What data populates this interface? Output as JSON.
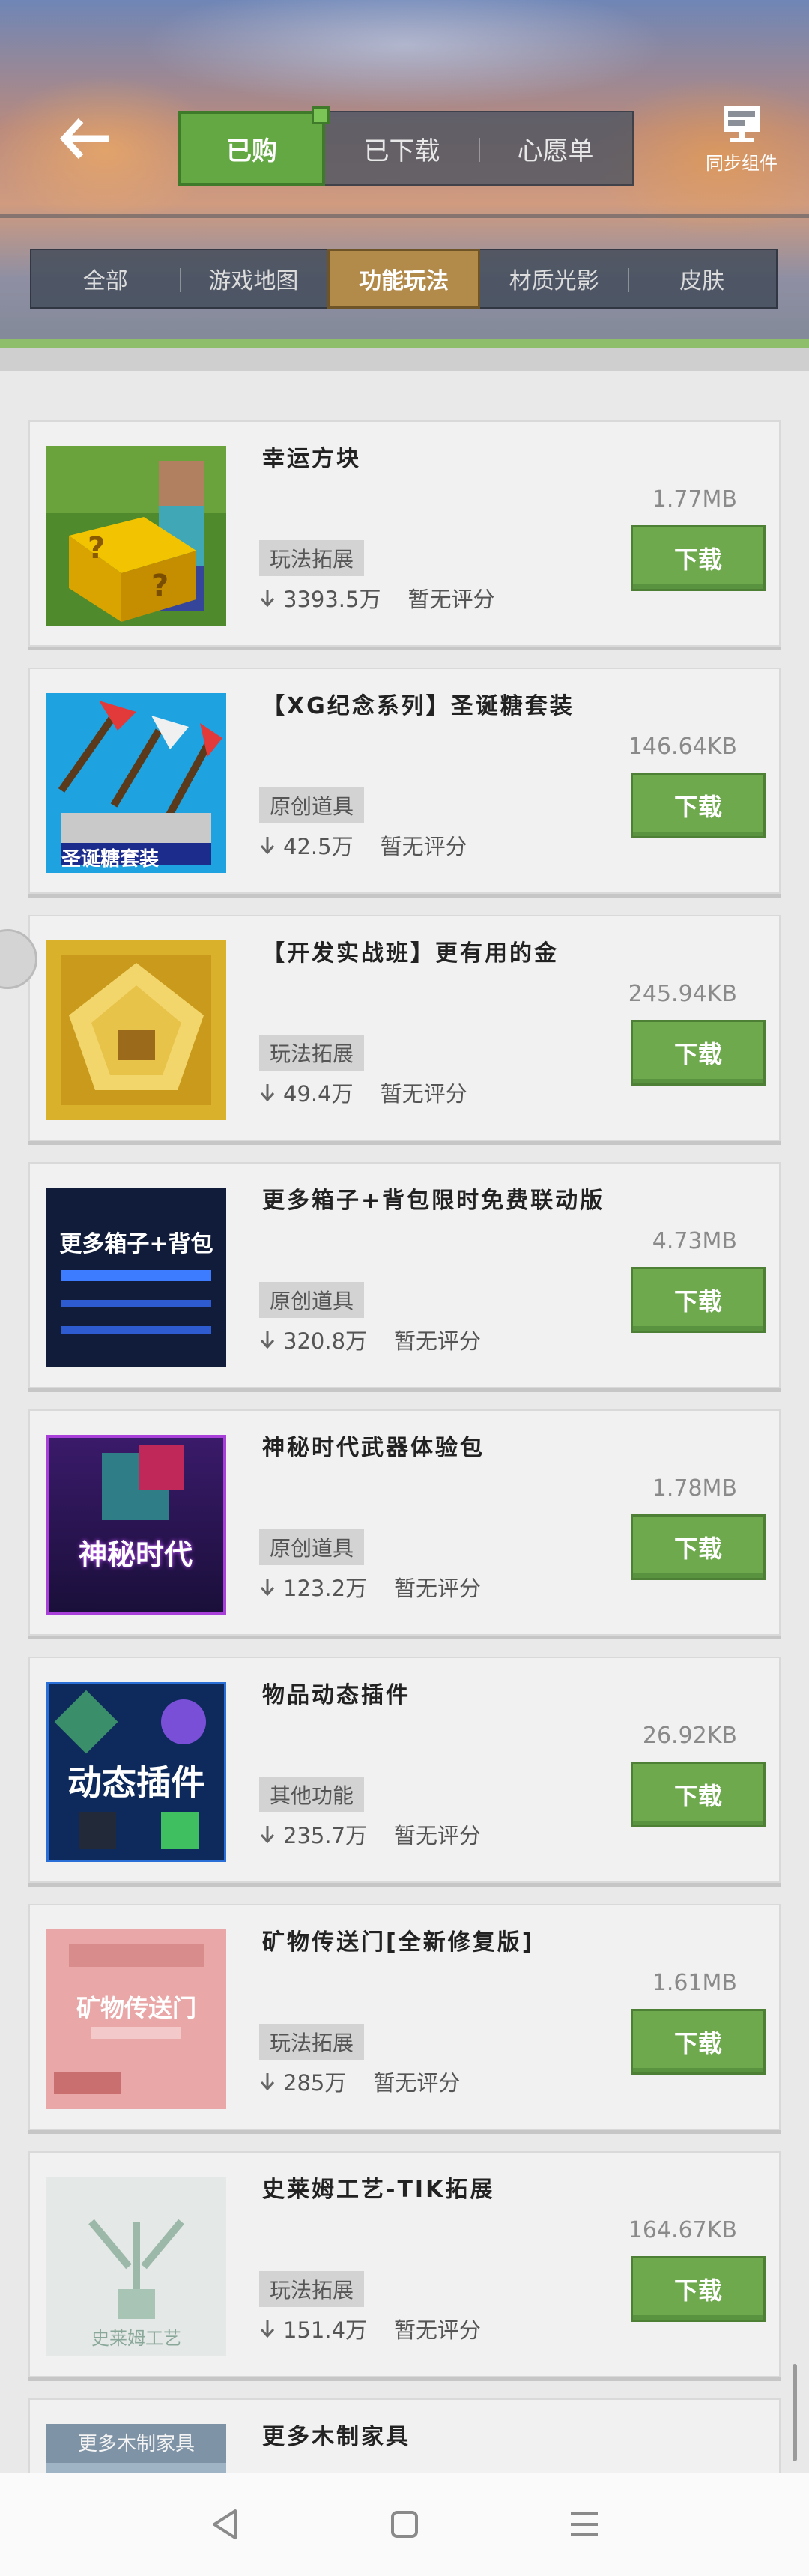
{
  "header": {
    "tabs": [
      {
        "label": "已购",
        "active": true
      },
      {
        "label": "已下载",
        "active": false
      },
      {
        "label": "心愿单",
        "active": false
      }
    ],
    "sync_label": "同步组件"
  },
  "categories": [
    {
      "label": "全部",
      "active": false
    },
    {
      "label": "游戏地图",
      "active": false
    },
    {
      "label": "功能玩法",
      "active": true
    },
    {
      "label": "材质光影",
      "active": false
    },
    {
      "label": "皮肤",
      "active": false
    }
  ],
  "items": [
    {
      "title": "幸运方块",
      "size": "1.77MB",
      "tag": "玩法拓展",
      "downloads": "3393.5万",
      "rating": "暂无评分",
      "button": "下载",
      "thumb_text": ""
    },
    {
      "title": "【XG纪念系列】圣诞糖套装",
      "size": "146.64KB",
      "tag": "原创道具",
      "downloads": "42.5万",
      "rating": "暂无评分",
      "button": "下载",
      "thumb_text": "圣诞糖套装"
    },
    {
      "title": "【开发实战班】更有用的金",
      "size": "245.94KB",
      "tag": "玩法拓展",
      "downloads": "49.4万",
      "rating": "暂无评分",
      "button": "下载",
      "thumb_text": ""
    },
    {
      "title": "更多箱子+背包限时免费联动版",
      "size": "4.73MB",
      "tag": "原创道具",
      "downloads": "320.8万",
      "rating": "暂无评分",
      "button": "下载",
      "thumb_text": "更多箱子+背包"
    },
    {
      "title": "神秘时代武器体验包",
      "size": "1.78MB",
      "tag": "原创道具",
      "downloads": "123.2万",
      "rating": "暂无评分",
      "button": "下载",
      "thumb_text": "神秘时代"
    },
    {
      "title": "物品动态插件",
      "size": "26.92KB",
      "tag": "其他功能",
      "downloads": "235.7万",
      "rating": "暂无评分",
      "button": "下载",
      "thumb_text": "动态插件"
    },
    {
      "title": "矿物传送门[全新修复版]",
      "size": "1.61MB",
      "tag": "玩法拓展",
      "downloads": "285万",
      "rating": "暂无评分",
      "button": "下载",
      "thumb_text": "矿物传送门"
    },
    {
      "title": "史莱姆工艺-TIK拓展",
      "size": "164.67KB",
      "tag": "玩法拓展",
      "downloads": "151.4万",
      "rating": "暂无评分",
      "button": "下载",
      "thumb_text": "史莱姆工艺"
    },
    {
      "title": "更多木制家具",
      "size": "",
      "tag": "",
      "downloads": "",
      "rating": "",
      "button": "",
      "thumb_text": "更多木制家具"
    }
  ],
  "colors": {
    "accent_green": "#6ea94e",
    "active_category": "#b28a49"
  },
  "icons": {
    "back": "arrow-left-icon",
    "sync": "sync-component-icon",
    "download_count": "arrow-down-icon"
  }
}
